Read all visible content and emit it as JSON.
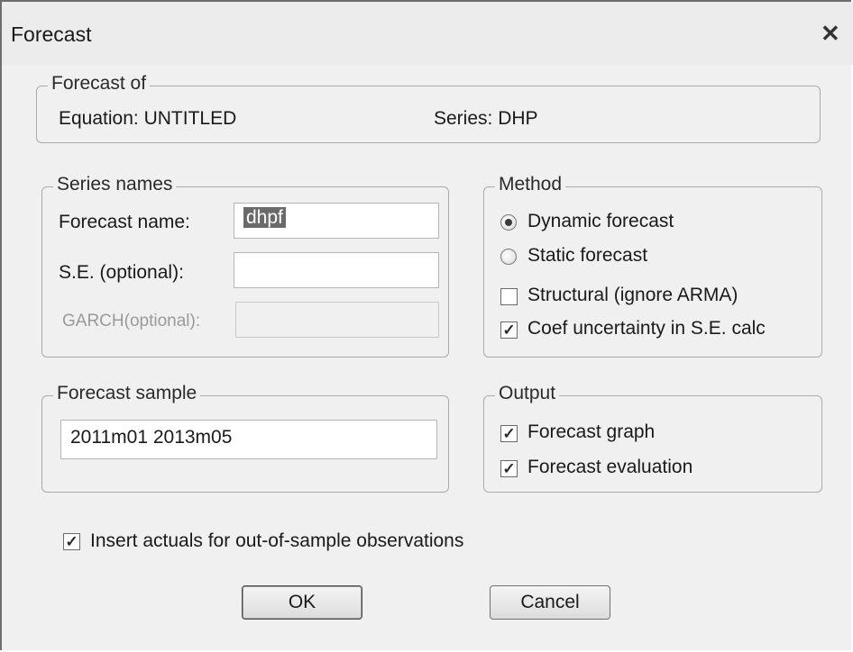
{
  "window": {
    "title": "Forecast"
  },
  "forecast_of": {
    "legend": "Forecast of",
    "equation": "Equation: UNTITLED",
    "series": "Series: DHP"
  },
  "series_names": {
    "legend": "Series names",
    "forecast_name_label": "Forecast name:",
    "forecast_name_value": "dhpf",
    "se_label": "S.E. (optional):",
    "se_value": "",
    "garch_label": "GARCH(optional):",
    "garch_value": ""
  },
  "method": {
    "legend": "Method",
    "dynamic": {
      "label": "Dynamic forecast",
      "selected": true
    },
    "static": {
      "label": "Static forecast",
      "selected": false
    },
    "structural": {
      "label": "Structural (ignore ARMA)",
      "checked": false
    },
    "coef": {
      "label": "Coef uncertainty in S.E. calc",
      "checked": true
    }
  },
  "forecast_sample": {
    "legend": "Forecast sample",
    "value": "2011m01 2013m05"
  },
  "output": {
    "legend": "Output",
    "graph": {
      "label": "Forecast graph",
      "checked": true
    },
    "evaluation": {
      "label": "Forecast evaluation",
      "checked": true
    }
  },
  "insert_actuals": {
    "label": "Insert actuals for out-of-sample observations",
    "checked": true
  },
  "buttons": {
    "ok": "OK",
    "cancel": "Cancel"
  },
  "icons": {
    "close": "close-icon",
    "check_mark": "✓"
  }
}
